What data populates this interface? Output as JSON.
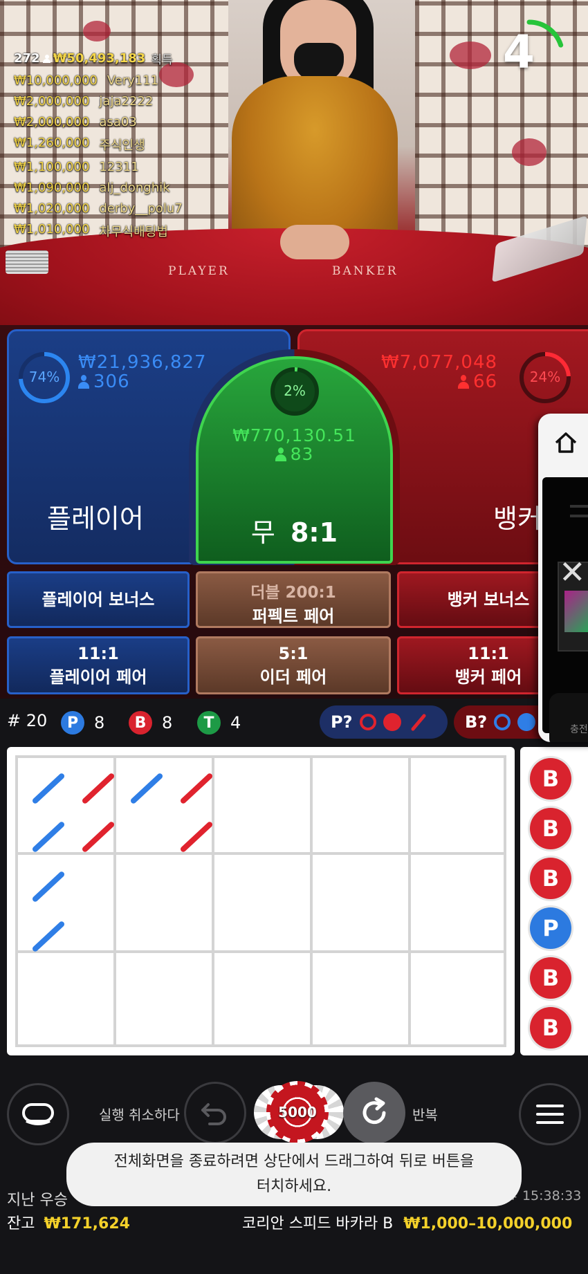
{
  "leaderboard": {
    "count": "272",
    "total": "₩50,493,183",
    "total_label": "획득",
    "rows": [
      {
        "amount": "₩10,000,000",
        "name": "Very111"
      },
      {
        "amount": "₩2,000,000",
        "name": "jaja2222"
      },
      {
        "amount": "₩2,000,000",
        "name": "asa03"
      },
      {
        "amount": "₩1,260,000",
        "name": "주식인생"
      },
      {
        "amount": "₩1,100,000",
        "name": "12311"
      },
      {
        "amount": "₩1,090,000",
        "name": "alj_donghik"
      },
      {
        "amount": "₩1,020,000",
        "name": "derby__polu7"
      },
      {
        "amount": "₩1,010,000",
        "name": "차무식배팅법"
      }
    ]
  },
  "timer": {
    "seconds": "4",
    "remaining_fraction": 0.2
  },
  "felt": {
    "player": "PLAYER",
    "banker": "BANKER"
  },
  "player": {
    "percent": "74%",
    "percent_value": 74,
    "amount": "₩21,936,827",
    "users": "306",
    "label": "플레이어"
  },
  "tie": {
    "percent": "2%",
    "percent_value": 2,
    "amount": "₩770,130.51",
    "users": "83",
    "label": "무",
    "odds": "8:1"
  },
  "banker": {
    "percent": "24%",
    "percent_value": 24,
    "amount": "₩7,077,048",
    "users": "66",
    "label": "뱅커"
  },
  "side_bets": {
    "player_bonus": "플레이어 보너스",
    "perfect_pair_odds": "더블 200:1",
    "perfect_pair": "퍼펙트 페어",
    "banker_bonus": "뱅커 보너스",
    "player_pair_odds": "11:1",
    "player_pair": "플레이어 페어",
    "either_pair_odds": "5:1",
    "either_pair": "이더 페어",
    "banker_pair_odds": "11:1",
    "banker_pair": "뱅커 페어"
  },
  "stats": {
    "round_label": "# 20",
    "player_letter": "P",
    "player_count": "8",
    "banker_letter": "B",
    "banker_count": "8",
    "tie_letter": "T",
    "tie_count": "4",
    "player_predict": "P?",
    "banker_predict": "B?"
  },
  "bead_road": [
    "B",
    "B",
    "B",
    "P",
    "B",
    "B"
  ],
  "side_panel": {
    "charge_label": "충전"
  },
  "controls": {
    "undo_label": "실행 취소하다",
    "chip_value": "5000",
    "repeat_label": "반복"
  },
  "toast": {
    "line1": "전체화면을 종료하려면 상단에서 드래그하여 뒤로 버튼을",
    "line2": "터치하세요."
  },
  "footer": {
    "last_win_label": "지난 우승",
    "game_id": "# 15:38:33",
    "balance_label": "잔고",
    "balance": "₩171,624",
    "table_name": "코리안 스피드 바카라 B",
    "limits": "₩1,000–10,000,000"
  },
  "colors": {
    "player": "#2c7ae0",
    "banker": "#d9232e",
    "tie": "#1d9a46",
    "gold": "#f4d12a"
  }
}
